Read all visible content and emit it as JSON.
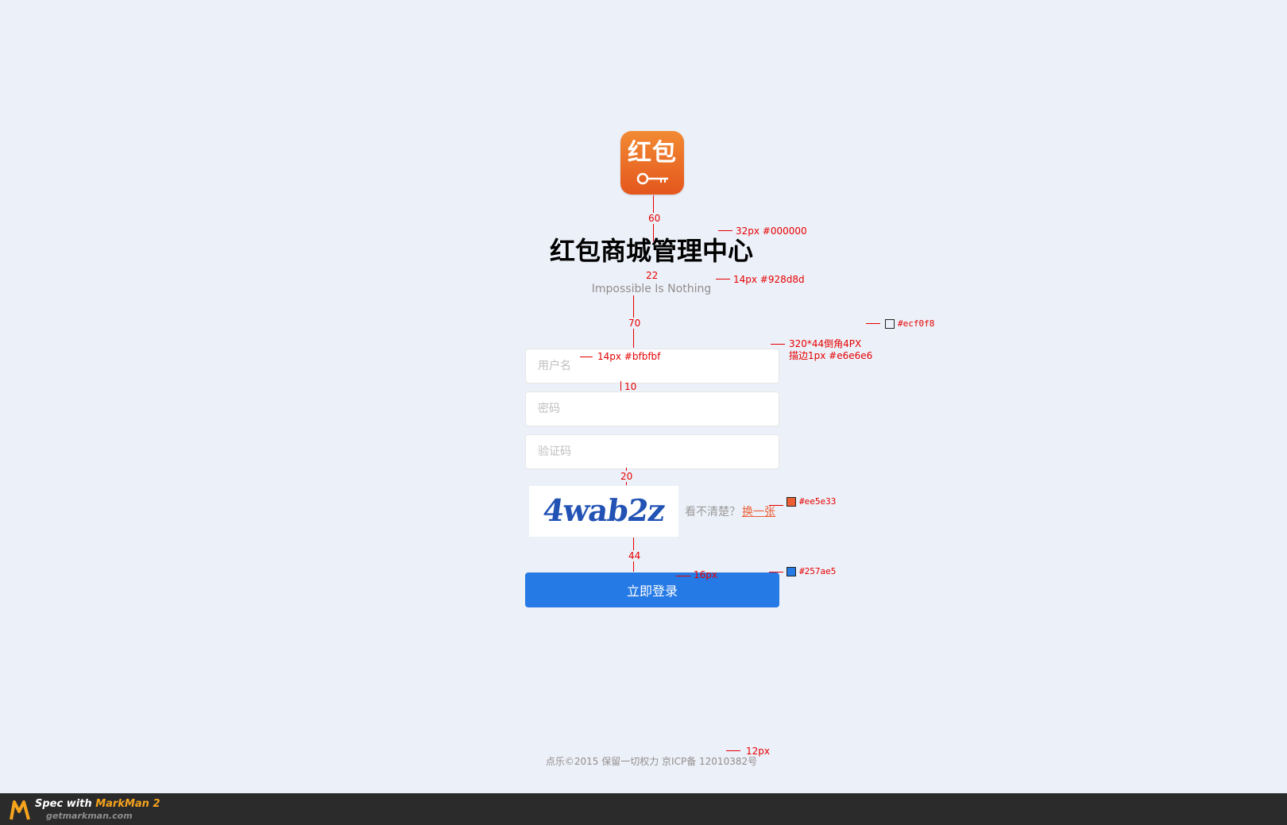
{
  "brand": {
    "logo_text": "红包",
    "title": "红包商城管理中心",
    "subtitle": "Impossible Is Nothing"
  },
  "form": {
    "username_placeholder": "用户名",
    "password_placeholder": "密码",
    "captcha_placeholder": "验证码",
    "captcha_code": "4wab2z",
    "captcha_hint": "看不清楚？",
    "captcha_refresh": "换一张",
    "login_label": "立即登录"
  },
  "footer": {
    "copyright": "点乐©2015 保留一切权力 京ICP备 12010382号"
  },
  "annotations": {
    "logo_gap": "60",
    "title_spec": "32px #000000",
    "title_gap": "22",
    "subtitle_spec": "14px  #928d8d",
    "form_gap": "70",
    "bg_color": "#ecf0f8",
    "input_spec_line1": "320*44倒角4PX",
    "input_spec_line2": "描边1px  #e6e6e6",
    "placeholder_spec": "14px  #bfbfbf",
    "input_gap": "10",
    "captcha_gap": "20",
    "refresh_color": "#ee5e33",
    "button_gap": "44",
    "button_font": "16px",
    "button_color": "#257ae5",
    "footer_font": "12px"
  },
  "markman": {
    "prefix": "Spec with ",
    "product": "MarkMan 2",
    "url": "getmarkman.com"
  },
  "colors": {
    "background": "#ecf0f8",
    "title": "#000000",
    "subtitle": "#928d8d",
    "placeholder": "#bfbfbf",
    "input_border": "#e6e6e6",
    "accent_orange": "#ee5e33",
    "button_blue": "#257ae5"
  }
}
